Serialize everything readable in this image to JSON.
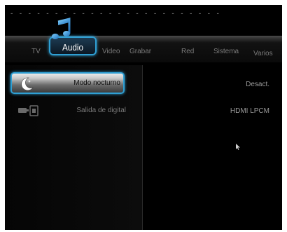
{
  "header": {
    "dashes": "- - - - - - - - - - - - - - - - - - - - - - - -"
  },
  "tabs": [
    {
      "label": "TV"
    },
    {
      "label": "Audio",
      "active": true
    },
    {
      "label": "Video"
    },
    {
      "label": "Grabar"
    },
    {
      "label": "Red"
    },
    {
      "label": "Sistema"
    },
    {
      "label": "Varios"
    }
  ],
  "settings": [
    {
      "label": "Modo nocturno",
      "value": "Desact.",
      "icon": "moon-icon",
      "selected": true
    },
    {
      "label": "Salida de digital",
      "value": "HDMI LPCM",
      "icon": "digital-output-icon"
    }
  ],
  "colors": {
    "accent": "#2f9fd3",
    "background": "#000000"
  }
}
